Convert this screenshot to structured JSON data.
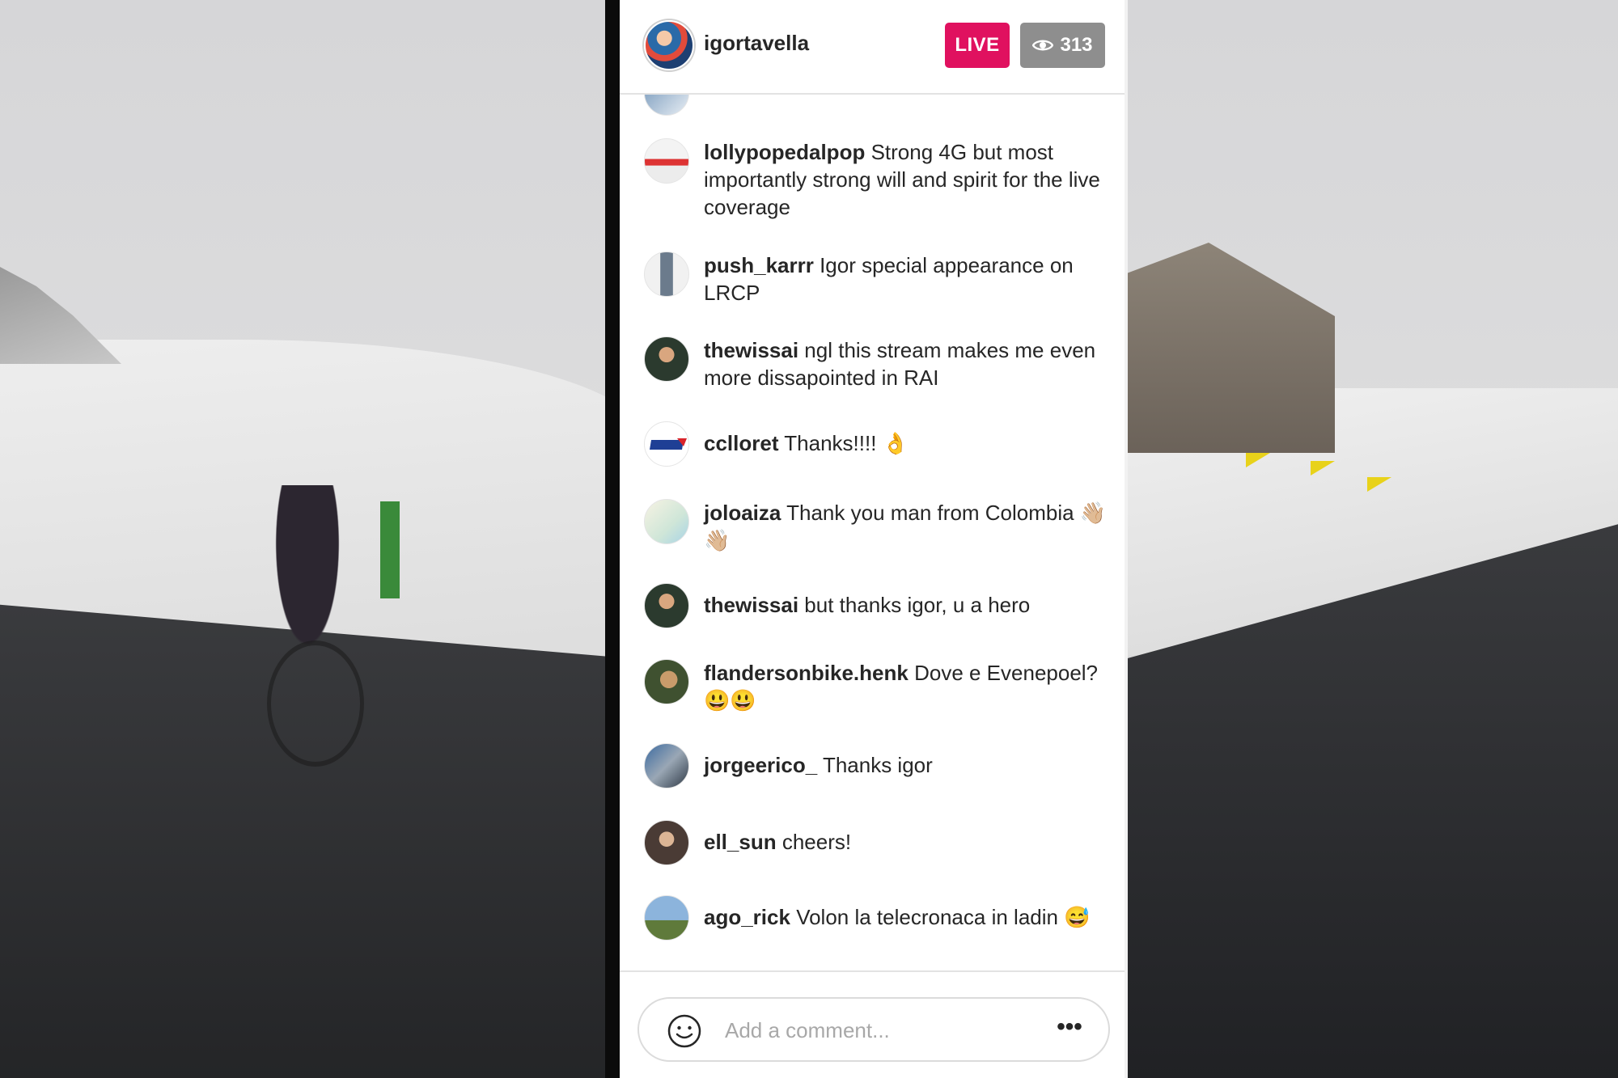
{
  "header": {
    "username": "igortavella",
    "live_label": "LIVE",
    "viewer_count": "313",
    "viewer_icon": "eye-icon"
  },
  "comments": [
    {
      "user": "lollypopedalpop",
      "text": "Strong 4G but most importantly strong will and spirit for the live coverage"
    },
    {
      "user": "push_karrr",
      "text": "Igor special appearance on LRCP"
    },
    {
      "user": "thewissai",
      "text": "ngl this stream makes me even more dissapointed in RAI"
    },
    {
      "user": "cclloret",
      "text": "Thanks!!!! 👌"
    },
    {
      "user": "joloaiza",
      "text": "Thank you man from Colombia 👋🏼👋🏼"
    },
    {
      "user": "thewissai",
      "text": "but thanks igor, u a hero"
    },
    {
      "user": "flandersonbike.henk",
      "text": "Dove e Evenepoel? 😃😃"
    },
    {
      "user": "jorgeerico_",
      "text": "Thanks igor"
    },
    {
      "user": "ell_sun",
      "text": "cheers!"
    },
    {
      "user": "ago_rick",
      "text": "Volon la telecronaca in ladin 😅"
    }
  ],
  "composer": {
    "placeholder": "Add a comment...",
    "emoji_icon": "smiley-icon",
    "more_icon": "more-icon"
  },
  "colors": {
    "live_badge": "#e0115f",
    "viewer_badge": "#8e8e8e",
    "text": "#262626"
  }
}
